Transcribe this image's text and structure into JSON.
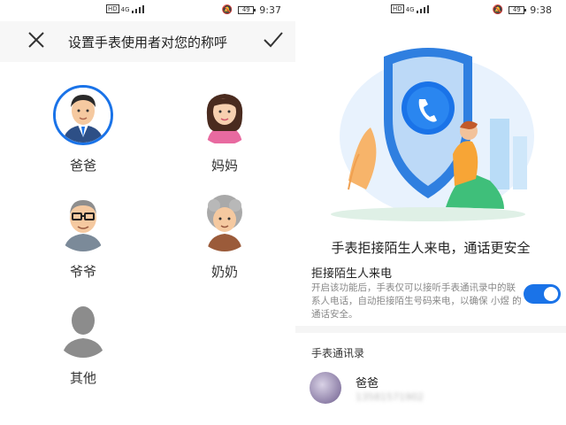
{
  "left_screen": {
    "status": {
      "time": "9:37",
      "network": "4G",
      "hd": "HD",
      "battery": "49"
    },
    "toolbar": {
      "title": "设置手表使用者对您的称呼"
    },
    "avatars": [
      {
        "label": "爸爸",
        "selected": true
      },
      {
        "label": "妈妈",
        "selected": false
      },
      {
        "label": "爷爷",
        "selected": false
      },
      {
        "label": "奶奶",
        "selected": false
      },
      {
        "label": "其他",
        "selected": false
      }
    ]
  },
  "right_screen": {
    "status": {
      "time": "9:38",
      "network": "4G",
      "hd": "HD",
      "battery": "49"
    },
    "headline": "手表拒接陌生人来电，通话更安全",
    "setting": {
      "title": "拒接陌生人来电",
      "description": "开启该功能后，手表仅可以接听手表通讯录中的联系人电话，自动拒接陌生号码来电，以确保 小煜 的通话安全。",
      "enabled": true
    },
    "contacts": {
      "section_title": "手表通讯录",
      "items": [
        {
          "name": "爸爸",
          "phone": "13581571902"
        }
      ]
    }
  },
  "colors": {
    "accent": "#1a73e8"
  }
}
